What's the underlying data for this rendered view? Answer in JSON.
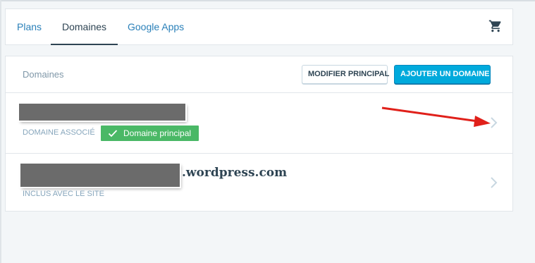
{
  "nav": {
    "tabs": [
      {
        "label": "Plans"
      },
      {
        "label": "Domaines"
      },
      {
        "label": "Google Apps"
      }
    ],
    "active_tab": "Domaines",
    "cart_icon": "cart-icon"
  },
  "domains": {
    "title": "Domaines",
    "modify_button": "MODIFIER PRINCIPAL",
    "add_button": "AJOUTER UN DOMAINE",
    "rows": [
      {
        "sublabel": "DOMAINE ASSOCIÉ",
        "badge": "Domaine principal"
      },
      {
        "domain_suffix": ".wordpress.com",
        "sublabel": "INCLUS AVEC LE SITE"
      }
    ]
  },
  "colors": {
    "accent": "#00aadc",
    "link": "#2a80b9",
    "badge_green": "#4ab866",
    "arrow_red": "#e0201a"
  }
}
